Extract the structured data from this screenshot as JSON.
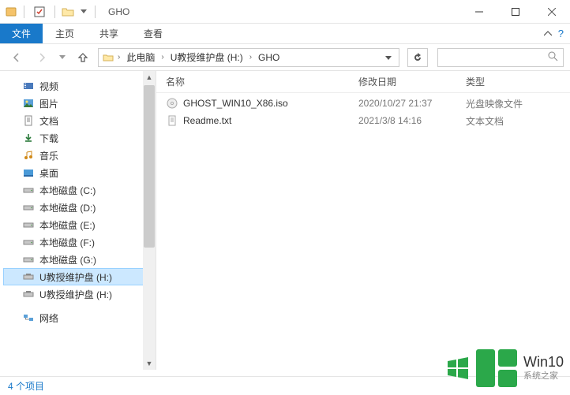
{
  "title": "GHO",
  "ribbon": {
    "file": "文件",
    "tabs": [
      "主页",
      "共享",
      "查看"
    ]
  },
  "breadcrumbs": [
    "此电脑",
    "U教授维护盘 (H:)",
    "GHO"
  ],
  "sidebar": {
    "items": [
      {
        "label": "视频"
      },
      {
        "label": "图片"
      },
      {
        "label": "文档"
      },
      {
        "label": "下载"
      },
      {
        "label": "音乐"
      },
      {
        "label": "桌面"
      },
      {
        "label": "本地磁盘 (C:)"
      },
      {
        "label": "本地磁盘 (D:)"
      },
      {
        "label": "本地磁盘 (E:)"
      },
      {
        "label": "本地磁盘 (F:)"
      },
      {
        "label": "本地磁盘 (G:)"
      },
      {
        "label": "U教授维护盘 (H:)",
        "selected": true
      },
      {
        "label": "U教授维护盘 (H:)"
      }
    ],
    "network": "网络"
  },
  "columns": {
    "name": "名称",
    "date": "修改日期",
    "type": "类型"
  },
  "files": [
    {
      "name": "GHOST_WIN10_X86.iso",
      "date": "2020/10/27 21:37",
      "type": "光盘映像文件",
      "icon": "disc"
    },
    {
      "name": "Readme.txt",
      "date": "2021/3/8 14:16",
      "type": "文本文档",
      "icon": "text"
    }
  ],
  "status": "4 个项目",
  "watermark": {
    "title": "Win10",
    "sub": "系统之家"
  }
}
